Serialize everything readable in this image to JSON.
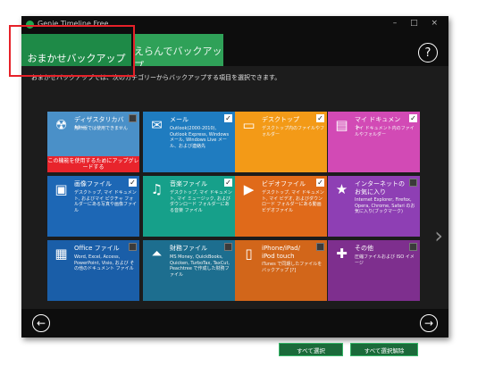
{
  "window": {
    "title": "Genie Timeline Free",
    "controls": "– □ ×"
  },
  "tabs": [
    {
      "label": "おまかせバックアップ",
      "active": true
    },
    {
      "label": "えらんでバックアップ",
      "active": false
    }
  ],
  "help_label": "?",
  "instruction": "おまかせバックアップでは、次のカテゴリーからバックアップする項目を選択できます。",
  "tiles": [
    {
      "title": "ディザスタリカバリー",
      "desc": "無料版では使用できません",
      "color": "#4a90c8",
      "icon": "radiation-icon",
      "checked": false,
      "warning": "この機能を使用するためにアップグレードする"
    },
    {
      "title": "メール",
      "desc": "Outlook(2000-2010), Outlook Express, Windows メール, Windows Live メール、および連絡先",
      "color": "#1f7cc0",
      "icon": "mail-icon",
      "checked": true
    },
    {
      "title": "デスクトップ",
      "desc": "デスクトップ内のファイルやフォルダー",
      "color": "#f39a17",
      "icon": "desktop-icon",
      "checked": true
    },
    {
      "title": "マイ ドキュメント",
      "desc": "マイ ドキュメント内のファイルやフォルダー",
      "color": "#d24ab5",
      "icon": "documents-icon",
      "checked": true
    },
    {
      "title": "画像ファイル",
      "desc": "デスクトップ, マイ ドキュメント, およびマイ ピクチャ フォルダーにある写真や画像ファイル",
      "color": "#1d67b5",
      "icon": "image-icon",
      "checked": true
    },
    {
      "title": "音楽ファイル",
      "desc": "デスクトップ, マイ ドキュメント, マイ ミュージック, およびダウンロード フォルダーにある音楽 ファイル",
      "color": "#16a08a",
      "icon": "music-icon",
      "checked": true
    },
    {
      "title": "ビデオファイル",
      "desc": "デスクトップ, マイ ドキュメント, マイ ビデオ, およびダウンロード フォルダーにある動画ビデオファイル",
      "color": "#e06a1a",
      "icon": "video-icon",
      "checked": true
    },
    {
      "title": "インターネットのお気に入り",
      "desc": "Internet Explorer, Firefox, Opera, Chrome, Safari のお気に入り(ブックマーク)",
      "color": "#8e3fb4",
      "icon": "star-icon",
      "checked": false
    },
    {
      "title": "Office ファイル",
      "desc": "Word, Excel, Access, PowerPoint, Visio, および その他のドキュメント ファイル",
      "color": "#1a5ea8",
      "icon": "office-icon",
      "checked": false
    },
    {
      "title": "財務ファイル",
      "desc": "MS Money, QuickBooks, Quicken, TurboTax, TaxCut, Peachtree で作成した財務ファイル",
      "color": "#1d6e8f",
      "icon": "finance-icon",
      "checked": false
    },
    {
      "title": "iPhone/iPad/ iPod touch",
      "desc": "iTunes で同期したファイルをバックアップ [?]",
      "color": "#d2661a",
      "icon": "phone-icon",
      "checked": false
    },
    {
      "title": "その他",
      "desc": "圧縮ファイルおよび ISO イメージ",
      "color": "#7e2f8e",
      "icon": "plus-icon",
      "checked": false
    }
  ],
  "buttons": {
    "select_all": "すべて選択",
    "deselect_all": "すべて選択解除"
  },
  "nav": {
    "back": "←",
    "forward": "→",
    "next_page": "›"
  }
}
